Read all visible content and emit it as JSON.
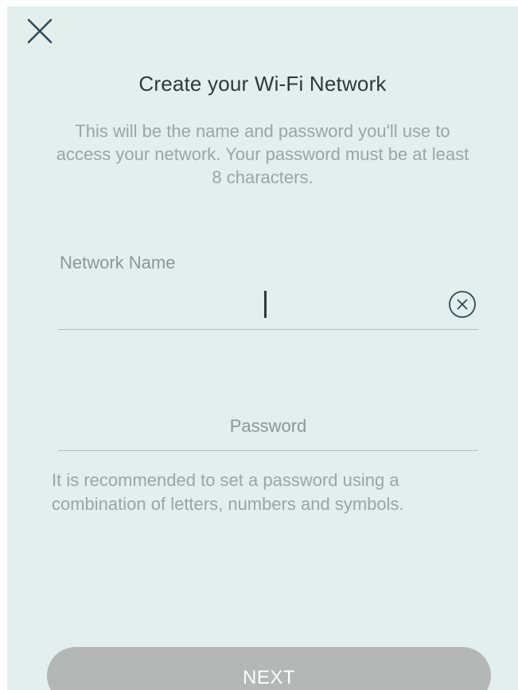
{
  "header": {
    "close_icon": "close-icon",
    "title": "Create your Wi-Fi Network",
    "subtitle": "This will be the name and password you'll use to access your network. Your password must be at least 8 characters."
  },
  "network_name": {
    "label": "Network Name",
    "value": "",
    "clear_icon": "clear-circle-x-icon"
  },
  "password": {
    "placeholder": "Password",
    "value": "",
    "hint": "It is recommended to set a password using a combination of letters, numbers and symbols."
  },
  "footer": {
    "next_label": "NEXT"
  },
  "colors": {
    "background": "#e3efec",
    "title": "#2e3a39",
    "muted_text": "#9aa6a4",
    "divider": "#b4bcba",
    "button_disabled": "#b5b7b7",
    "button_text": "#ffffff"
  }
}
